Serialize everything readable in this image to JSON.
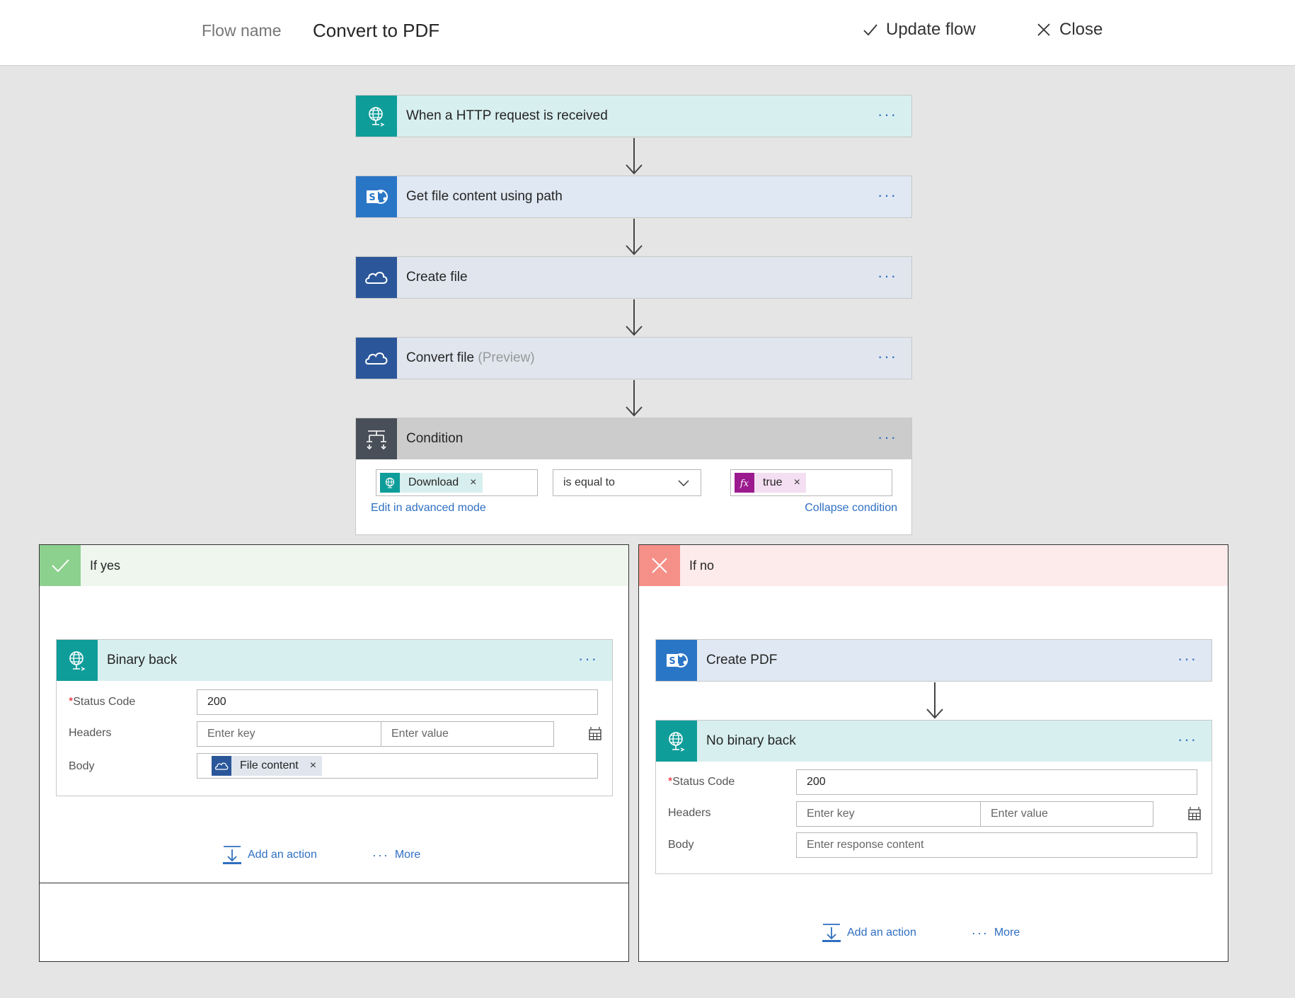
{
  "header": {
    "flow_name_label": "Flow name",
    "flow_name": "Convert to PDF",
    "update_label": "Update flow",
    "close_label": "Close"
  },
  "steps": {
    "trigger": {
      "title": "When a HTTP request is received",
      "more": "···"
    },
    "get_file": {
      "title": "Get file content using path",
      "more": "···"
    },
    "create_file": {
      "title": "Create file",
      "more": "···"
    },
    "convert_file": {
      "title": "Convert file",
      "preview": "(Preview)",
      "more": "···"
    },
    "condition": {
      "title": "Condition",
      "more": "···",
      "left_token": "Download",
      "operator": "is equal to",
      "right_token": "true",
      "token_remove": "×",
      "edit_advanced": "Edit in advanced mode",
      "collapse": "Collapse condition"
    }
  },
  "branch_yes": {
    "title": "If yes",
    "action": {
      "title": "Binary back",
      "more": "···",
      "status_label": "Status Code",
      "required_mark": "*",
      "status_value": "200",
      "headers_label": "Headers",
      "key_placeholder": "Enter key",
      "value_placeholder": "Enter value",
      "body_label": "Body",
      "body_token": "File content",
      "token_remove": "×"
    },
    "add_action": "Add an action",
    "more_dots": "···",
    "more_label": "More"
  },
  "branch_no": {
    "title": "If no",
    "create_pdf": {
      "title": "Create PDF",
      "more": "···"
    },
    "action": {
      "title": "No binary back",
      "more": "···",
      "status_label": "Status Code",
      "required_mark": "*",
      "status_value": "200",
      "headers_label": "Headers",
      "key_placeholder": "Enter key",
      "value_placeholder": "Enter value",
      "body_label": "Body",
      "body_placeholder": "Enter response content"
    },
    "add_action": "Add an action",
    "more_dots": "···",
    "more_label": "More"
  },
  "colors": {
    "http_teal": "#0f9d9a",
    "http_bg": "#d8efef",
    "sharepoint_blue": "#2a76c6",
    "sharepoint_bg": "#dfe8f3",
    "onedrive_blue": "#2b579a",
    "onedrive_bg": "#e0e5ee",
    "condition_dark": "#484f58",
    "condition_bg": "#cccccc",
    "yes_green": "#8dd18f",
    "yes_bg": "#eef6ee",
    "no_red": "#f59089",
    "no_bg": "#fdeaea",
    "fx_purple": "#9b1b8f",
    "link_blue": "#2f6fc1"
  },
  "icons": [
    "globe-icon",
    "sharepoint-icon",
    "onedrive-cloud-icon",
    "condition-icon",
    "check-icon",
    "x-icon",
    "fx-icon",
    "table-icon",
    "add-action-icon",
    "chevron-down-icon"
  ]
}
